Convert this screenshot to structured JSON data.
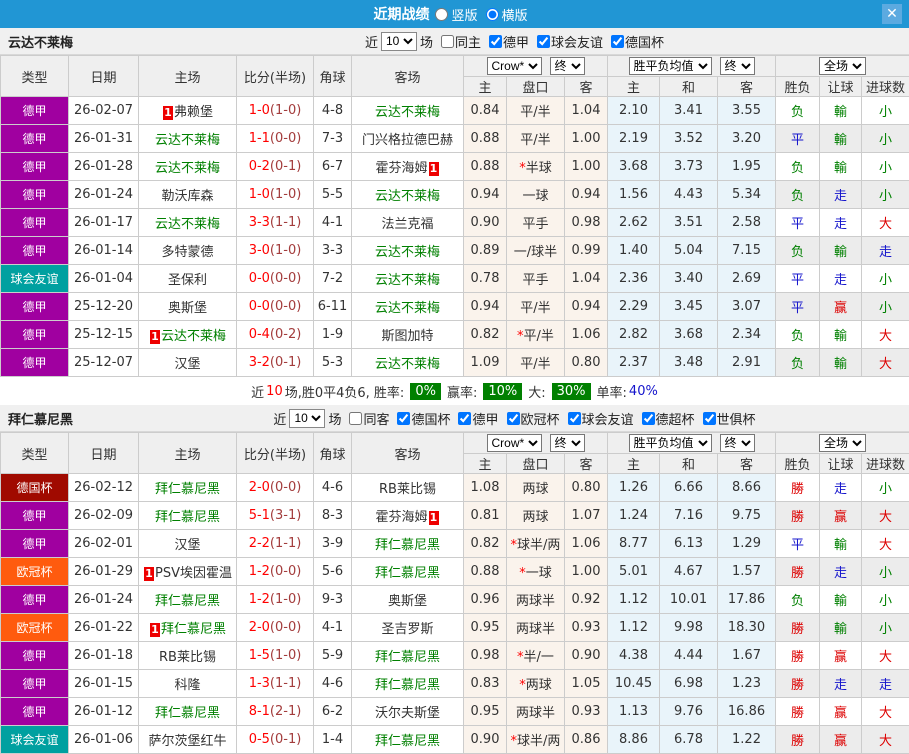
{
  "titlebar": {
    "title": "近期战绩",
    "radios": [
      {
        "label": "竖版",
        "checked": false
      },
      {
        "label": "横版",
        "checked": true
      }
    ],
    "close_glyph": "✕"
  },
  "colors": {
    "titlebar_blue": "#2196d4",
    "league": {
      "德甲": "#a000a0",
      "球会友谊": "#00a0a0",
      "德国杯": "#a00a00",
      "欧冠杯": "#ff5b0e"
    },
    "team_green": "#008000",
    "score_red": "#ff0000",
    "result_green": "#008000",
    "result_red": "#dd0000",
    "result_blue": "#1414cc",
    "summary_badge_green": "#008000"
  },
  "columns": {
    "left": [
      "类型",
      "日期",
      "主场",
      "比分(半场)",
      "角球",
      "客场"
    ],
    "odds_sub": [
      "主",
      "盘口",
      "客"
    ],
    "avg_sub": [
      "主",
      "和",
      "客"
    ],
    "result_sub": [
      "胜负",
      "让球",
      "进球数"
    ]
  },
  "dropdowns": {
    "odds_source": "Crow*",
    "odds_time": "终",
    "avg_type": "胜平负均值",
    "avg_time": "终",
    "scope": "全场"
  },
  "sections": [
    {
      "team": "云达不莱梅",
      "filter": {
        "near": "近",
        "count": "10",
        "games": "场",
        "same": {
          "label": "同主",
          "checked": false
        },
        "leagues": [
          {
            "label": "德甲",
            "checked": true
          },
          {
            "label": "球会友谊",
            "checked": true
          },
          {
            "label": "德国杯",
            "checked": true
          }
        ]
      },
      "rows": [
        {
          "league": "德甲",
          "date": "26-02-07",
          "home": "弗赖堡",
          "home_green": false,
          "home_card": true,
          "score": "1-0",
          "half": "(1-0)",
          "corners": "4-8",
          "away": "云达不莱梅",
          "away_green": true,
          "away_card": false,
          "odds_home": "0.84",
          "handicap": "平/半",
          "star": false,
          "odds_away": "1.04",
          "avg_home": "2.10",
          "avg_draw": "3.41",
          "avg_away": "3.55",
          "results": [
            [
              "负",
              "green"
            ],
            [
              "輸",
              "green"
            ],
            [
              "小",
              "green"
            ]
          ]
        },
        {
          "league": "德甲",
          "date": "26-01-31",
          "home": "云达不莱梅",
          "home_green": true,
          "home_card": false,
          "score": "1-1",
          "half": "(0-0)",
          "corners": "7-3",
          "away": "门兴格拉德巴赫",
          "away_green": false,
          "away_card": false,
          "odds_home": "0.88",
          "handicap": "平/半",
          "star": false,
          "odds_away": "1.00",
          "avg_home": "2.19",
          "avg_draw": "3.52",
          "avg_away": "3.20",
          "results": [
            [
              "平",
              "blue"
            ],
            [
              "輸",
              "green"
            ],
            [
              "小",
              "green"
            ]
          ]
        },
        {
          "league": "德甲",
          "date": "26-01-28",
          "home": "云达不莱梅",
          "home_green": true,
          "home_card": false,
          "score": "0-2",
          "half": "(0-1)",
          "corners": "6-7",
          "away": "霍芬海姆",
          "away_green": false,
          "away_card": true,
          "odds_home": "0.88",
          "handicap": "半球",
          "star": true,
          "odds_away": "1.00",
          "avg_home": "3.68",
          "avg_draw": "3.73",
          "avg_away": "1.95",
          "results": [
            [
              "负",
              "green"
            ],
            [
              "輸",
              "green"
            ],
            [
              "小",
              "green"
            ]
          ]
        },
        {
          "league": "德甲",
          "date": "26-01-24",
          "home": "勒沃库森",
          "home_green": false,
          "home_card": false,
          "score": "1-0",
          "half": "(1-0)",
          "corners": "5-5",
          "away": "云达不莱梅",
          "away_green": true,
          "away_card": false,
          "odds_home": "0.94",
          "handicap": "一球",
          "star": false,
          "odds_away": "0.94",
          "avg_home": "1.56",
          "avg_draw": "4.43",
          "avg_away": "5.34",
          "results": [
            [
              "负",
              "green"
            ],
            [
              "走",
              "blue"
            ],
            [
              "小",
              "green"
            ]
          ]
        },
        {
          "league": "德甲",
          "date": "26-01-17",
          "home": "云达不莱梅",
          "home_green": true,
          "home_card": false,
          "score": "3-3",
          "half": "(1-1)",
          "corners": "4-1",
          "away": "法兰克福",
          "away_green": false,
          "away_card": false,
          "odds_home": "0.90",
          "handicap": "平手",
          "star": false,
          "odds_away": "0.98",
          "avg_home": "2.62",
          "avg_draw": "3.51",
          "avg_away": "2.58",
          "results": [
            [
              "平",
              "blue"
            ],
            [
              "走",
              "blue"
            ],
            [
              "大",
              "red"
            ]
          ]
        },
        {
          "league": "德甲",
          "date": "26-01-14",
          "home": "多特蒙德",
          "home_green": false,
          "home_card": false,
          "score": "3-0",
          "half": "(1-0)",
          "corners": "3-3",
          "away": "云达不莱梅",
          "away_green": true,
          "away_card": false,
          "odds_home": "0.89",
          "handicap": "一/球半",
          "star": false,
          "odds_away": "0.99",
          "avg_home": "1.40",
          "avg_draw": "5.04",
          "avg_away": "7.15",
          "results": [
            [
              "负",
              "green"
            ],
            [
              "輸",
              "green"
            ],
            [
              "走",
              "blue"
            ]
          ]
        },
        {
          "league": "球会友谊",
          "date": "26-01-04",
          "home": "圣保利",
          "home_green": false,
          "home_card": false,
          "score": "0-0",
          "half": "(0-0)",
          "corners": "7-2",
          "away": "云达不莱梅",
          "away_green": true,
          "away_card": false,
          "odds_home": "0.78",
          "handicap": "平手",
          "star": false,
          "odds_away": "1.04",
          "avg_home": "2.36",
          "avg_draw": "3.40",
          "avg_away": "2.69",
          "results": [
            [
              "平",
              "blue"
            ],
            [
              "走",
              "blue"
            ],
            [
              "小",
              "green"
            ]
          ]
        },
        {
          "league": "德甲",
          "date": "25-12-20",
          "home": "奥斯堡",
          "home_green": false,
          "home_card": false,
          "score": "0-0",
          "half": "(0-0)",
          "corners": "6-11",
          "away": "云达不莱梅",
          "away_green": true,
          "away_card": false,
          "odds_home": "0.94",
          "handicap": "平/半",
          "star": false,
          "odds_away": "0.94",
          "avg_home": "2.29",
          "avg_draw": "3.45",
          "avg_away": "3.07",
          "results": [
            [
              "平",
              "blue"
            ],
            [
              "赢",
              "red"
            ],
            [
              "小",
              "green"
            ]
          ]
        },
        {
          "league": "德甲",
          "date": "25-12-15",
          "home": "云达不莱梅",
          "home_green": true,
          "home_card": true,
          "score": "0-4",
          "half": "(0-2)",
          "corners": "1-9",
          "away": "斯图加特",
          "away_green": false,
          "away_card": false,
          "odds_home": "0.82",
          "handicap": "平/半",
          "star": true,
          "odds_away": "1.06",
          "avg_home": "2.82",
          "avg_draw": "3.68",
          "avg_away": "2.34",
          "results": [
            [
              "负",
              "green"
            ],
            [
              "輸",
              "green"
            ],
            [
              "大",
              "red"
            ]
          ]
        },
        {
          "league": "德甲",
          "date": "25-12-07",
          "home": "汉堡",
          "home_green": false,
          "home_card": false,
          "score": "3-2",
          "half": "(0-1)",
          "corners": "5-3",
          "away": "云达不莱梅",
          "away_green": true,
          "away_card": false,
          "odds_home": "1.09",
          "handicap": "平/半",
          "star": false,
          "odds_away": "0.80",
          "avg_home": "2.37",
          "avg_draw": "3.48",
          "avg_away": "2.91",
          "results": [
            [
              "负",
              "green"
            ],
            [
              "輸",
              "green"
            ],
            [
              "大",
              "red"
            ]
          ]
        }
      ],
      "summary": {
        "pre": "近",
        "count": "10",
        "mid": "场,胜0平4负6, 胜率:",
        "rate1": "0%",
        "label2": "赢率:",
        "rate2": "10%",
        "label3": "大:",
        "rate3": "30%",
        "label4": "单率:",
        "rate4": "40%"
      }
    },
    {
      "team": "拜仁慕尼黑",
      "filter": {
        "near": "近",
        "count": "10",
        "games": "场",
        "same": {
          "label": "同客",
          "checked": false
        },
        "leagues": [
          {
            "label": "德国杯",
            "checked": true
          },
          {
            "label": "德甲",
            "checked": true
          },
          {
            "label": "欧冠杯",
            "checked": true
          },
          {
            "label": "球会友谊",
            "checked": true
          },
          {
            "label": "德超杯",
            "checked": true
          },
          {
            "label": "世俱杯",
            "checked": true
          }
        ]
      },
      "rows": [
        {
          "league": "德国杯",
          "date": "26-02-12",
          "home": "拜仁慕尼黑",
          "home_green": true,
          "home_card": false,
          "score": "2-0",
          "half": "(0-0)",
          "corners": "4-6",
          "away": "RB莱比锡",
          "away_green": false,
          "away_card": false,
          "odds_home": "1.08",
          "handicap": "两球",
          "star": false,
          "odds_away": "0.80",
          "avg_home": "1.26",
          "avg_draw": "6.66",
          "avg_away": "8.66",
          "results": [
            [
              "勝",
              "red"
            ],
            [
              "走",
              "blue"
            ],
            [
              "小",
              "green"
            ]
          ]
        },
        {
          "league": "德甲",
          "date": "26-02-09",
          "home": "拜仁慕尼黑",
          "home_green": true,
          "home_card": false,
          "score": "5-1",
          "half": "(3-1)",
          "corners": "8-3",
          "away": "霍芬海姆",
          "away_green": false,
          "away_card": true,
          "odds_home": "0.81",
          "handicap": "两球",
          "star": false,
          "odds_away": "1.07",
          "avg_home": "1.24",
          "avg_draw": "7.16",
          "avg_away": "9.75",
          "results": [
            [
              "勝",
              "red"
            ],
            [
              "赢",
              "red"
            ],
            [
              "大",
              "red"
            ]
          ]
        },
        {
          "league": "德甲",
          "date": "26-02-01",
          "home": "汉堡",
          "home_green": false,
          "home_card": false,
          "score": "2-2",
          "half": "(1-1)",
          "corners": "3-9",
          "away": "拜仁慕尼黑",
          "away_green": true,
          "away_card": false,
          "odds_home": "0.82",
          "handicap": "球半/两",
          "star": true,
          "odds_away": "1.06",
          "avg_home": "8.77",
          "avg_draw": "6.13",
          "avg_away": "1.29",
          "results": [
            [
              "平",
              "blue"
            ],
            [
              "輸",
              "green"
            ],
            [
              "大",
              "red"
            ]
          ]
        },
        {
          "league": "欧冠杯",
          "date": "26-01-29",
          "home": "PSV埃因霍温",
          "home_green": false,
          "home_card": true,
          "score": "1-2",
          "half": "(0-0)",
          "corners": "5-6",
          "away": "拜仁慕尼黑",
          "away_green": true,
          "away_card": false,
          "odds_home": "0.88",
          "handicap": "一球",
          "star": true,
          "odds_away": "1.00",
          "avg_home": "5.01",
          "avg_draw": "4.67",
          "avg_away": "1.57",
          "results": [
            [
              "勝",
              "red"
            ],
            [
              "走",
              "blue"
            ],
            [
              "小",
              "green"
            ]
          ]
        },
        {
          "league": "德甲",
          "date": "26-01-24",
          "home": "拜仁慕尼黑",
          "home_green": true,
          "home_card": false,
          "score": "1-2",
          "half": "(1-0)",
          "corners": "9-3",
          "away": "奥斯堡",
          "away_green": false,
          "away_card": false,
          "odds_home": "0.96",
          "handicap": "两球半",
          "star": false,
          "odds_away": "0.92",
          "avg_home": "1.12",
          "avg_draw": "10.01",
          "avg_away": "17.86",
          "results": [
            [
              "负",
              "green"
            ],
            [
              "輸",
              "green"
            ],
            [
              "小",
              "green"
            ]
          ]
        },
        {
          "league": "欧冠杯",
          "date": "26-01-22",
          "home": "拜仁慕尼黑",
          "home_green": true,
          "home_card": true,
          "score": "2-0",
          "half": "(0-0)",
          "corners": "4-1",
          "away": "圣吉罗斯",
          "away_green": false,
          "away_card": false,
          "odds_home": "0.95",
          "handicap": "两球半",
          "star": false,
          "odds_away": "0.93",
          "avg_home": "1.12",
          "avg_draw": "9.98",
          "avg_away": "18.30",
          "results": [
            [
              "勝",
              "red"
            ],
            [
              "輸",
              "green"
            ],
            [
              "小",
              "green"
            ]
          ]
        },
        {
          "league": "德甲",
          "date": "26-01-18",
          "home": "RB莱比锡",
          "home_green": false,
          "home_card": false,
          "score": "1-5",
          "half": "(1-0)",
          "corners": "5-9",
          "away": "拜仁慕尼黑",
          "away_green": true,
          "away_card": false,
          "odds_home": "0.98",
          "handicap": "半/一",
          "star": true,
          "odds_away": "0.90",
          "avg_home": "4.38",
          "avg_draw": "4.44",
          "avg_away": "1.67",
          "results": [
            [
              "勝",
              "red"
            ],
            [
              "赢",
              "red"
            ],
            [
              "大",
              "red"
            ]
          ]
        },
        {
          "league": "德甲",
          "date": "26-01-15",
          "home": "科隆",
          "home_green": false,
          "home_card": false,
          "score": "1-3",
          "half": "(1-1)",
          "corners": "4-6",
          "away": "拜仁慕尼黑",
          "away_green": true,
          "away_card": false,
          "odds_home": "0.83",
          "handicap": "两球",
          "star": true,
          "odds_away": "1.05",
          "avg_home": "10.45",
          "avg_draw": "6.98",
          "avg_away": "1.23",
          "results": [
            [
              "勝",
              "red"
            ],
            [
              "走",
              "blue"
            ],
            [
              "走",
              "blue"
            ]
          ]
        },
        {
          "league": "德甲",
          "date": "26-01-12",
          "home": "拜仁慕尼黑",
          "home_green": true,
          "home_card": false,
          "score": "8-1",
          "half": "(2-1)",
          "corners": "6-2",
          "away": "沃尔夫斯堡",
          "away_green": false,
          "away_card": false,
          "odds_home": "0.95",
          "handicap": "两球半",
          "star": false,
          "odds_away": "0.93",
          "avg_home": "1.13",
          "avg_draw": "9.76",
          "avg_away": "16.86",
          "results": [
            [
              "勝",
              "red"
            ],
            [
              "赢",
              "red"
            ],
            [
              "大",
              "red"
            ]
          ]
        },
        {
          "league": "球会友谊",
          "date": "26-01-06",
          "home": "萨尔茨堡红牛",
          "home_green": false,
          "home_card": false,
          "score": "0-5",
          "half": "(0-1)",
          "corners": "1-4",
          "away": "拜仁慕尼黑",
          "away_green": true,
          "away_card": false,
          "odds_home": "0.90",
          "handicap": "球半/两",
          "star": true,
          "odds_away": "0.86",
          "avg_home": "8.86",
          "avg_draw": "6.78",
          "avg_away": "1.22",
          "results": [
            [
              "勝",
              "red"
            ],
            [
              "赢",
              "red"
            ],
            [
              "大",
              "red"
            ]
          ]
        }
      ],
      "summary": null
    }
  ]
}
